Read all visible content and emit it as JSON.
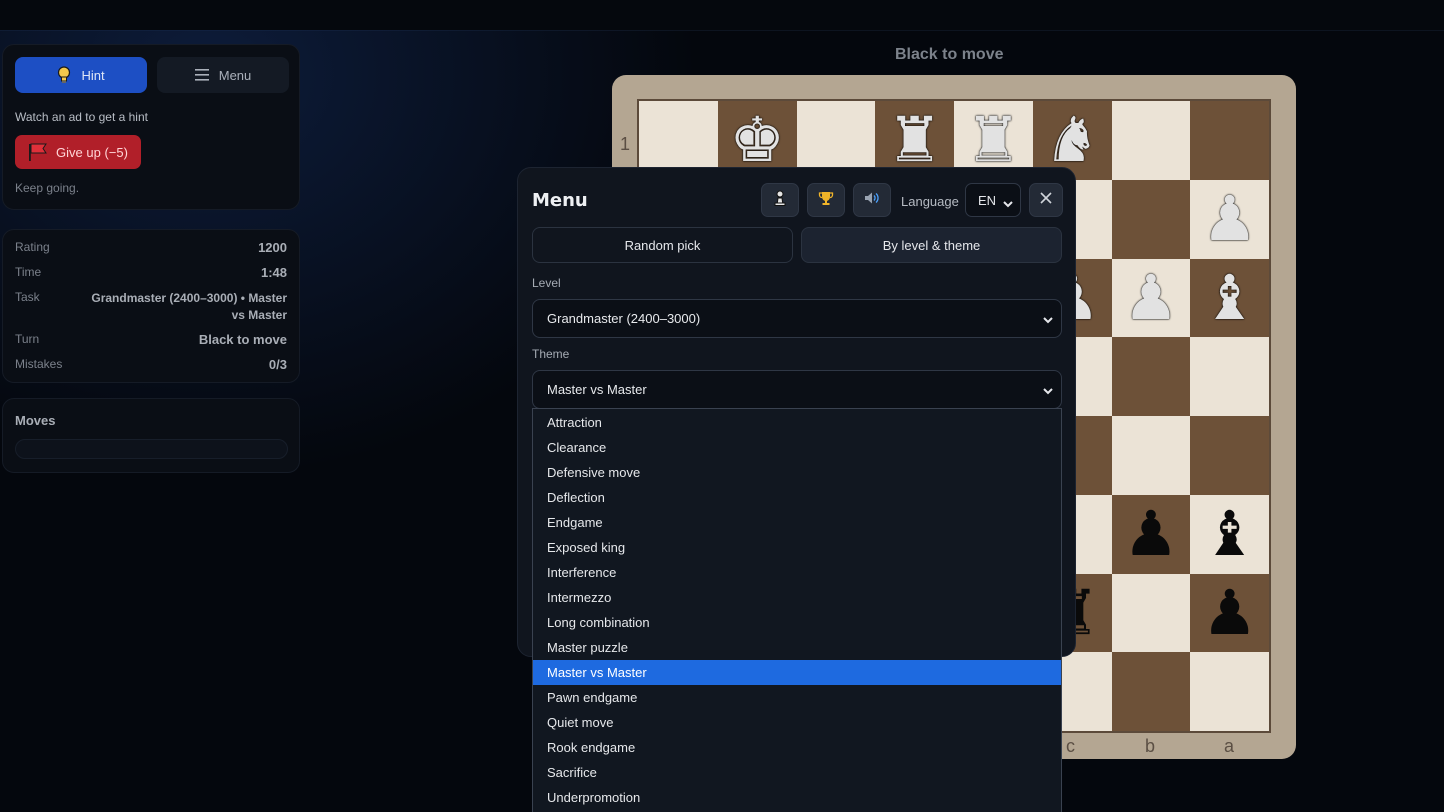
{
  "left_panel": {
    "hint_label": "Hint",
    "menu_label": "Menu",
    "ad_note": "Watch an ad to get a hint",
    "give_up_label": "Give up (−5)",
    "status_note": "Keep going."
  },
  "stats": {
    "rating_label": "Rating",
    "rating_value": "1200",
    "time_label": "Time",
    "time_value": "1:48",
    "task_label": "Task",
    "task_value_line1": "Grandmaster (2400–3000) • Master",
    "task_value_line2": "vs Master",
    "turn_label": "Turn",
    "turn_value": "Black to move",
    "mistakes_label": "Mistakes",
    "mistakes_value": "0/3"
  },
  "moves": {
    "title": "Moves"
  },
  "board": {
    "turn_title": "Black to move",
    "rank_label": "1",
    "file_labels": [
      "c",
      "b",
      "a"
    ]
  },
  "menu": {
    "title": "Menu",
    "language_label": "Language",
    "language_value": "EN",
    "mode_random": "Random pick",
    "mode_level": "By level & theme",
    "level_label": "Level",
    "level_value": "Grandmaster (2400–3000)",
    "theme_label": "Theme",
    "theme_value": "Master vs Master"
  },
  "theme_options": [
    "Attraction",
    "Clearance",
    "Defensive move",
    "Deflection",
    "Endgame",
    "Exposed king",
    "Interference",
    "Intermezzo",
    "Long combination",
    "Master puzzle",
    "Master vs Master",
    "Pawn endgame",
    "Quiet move",
    "Rook endgame",
    "Sacrifice",
    "Underpromotion"
  ],
  "selected_theme_index": 10,
  "colors": {
    "accent_blue": "#1d4fc4",
    "danger_red": "#b11f29",
    "option_highlight": "#1e6ae0",
    "board_light": "#ebe3d6",
    "board_dark": "#6d5138"
  }
}
